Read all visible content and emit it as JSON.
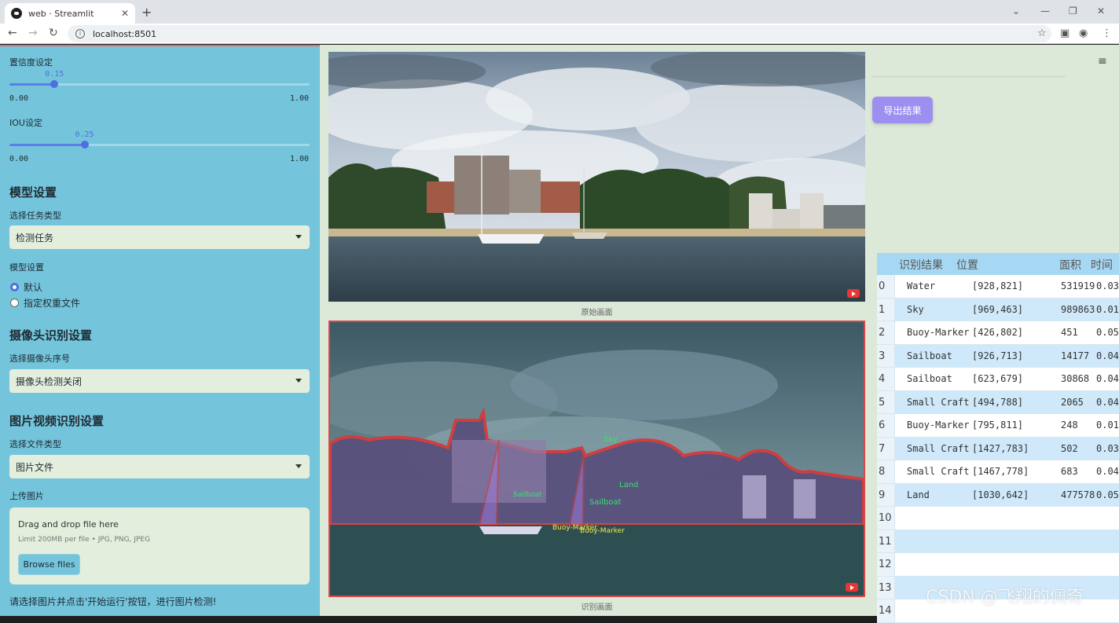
{
  "browser": {
    "tab_title": "web · Streamlit",
    "url": "localhost:8501"
  },
  "sidebar": {
    "confidence": {
      "label": "置信度设定",
      "value": "0.15",
      "fraction": 0.15,
      "min": "0.00",
      "max": "1.00"
    },
    "iou": {
      "label": "IOU设定",
      "value": "0.25",
      "fraction": 0.25,
      "min": "0.00",
      "max": "1.00"
    },
    "model_section": "模型设置",
    "task_label": "选择任务类型",
    "task_value": "检测任务",
    "model_label": "模型设置",
    "radio": [
      {
        "label": "默认",
        "selected": true
      },
      {
        "label": "指定权重文件",
        "selected": false
      }
    ],
    "camera_section": "摄像头识别设置",
    "camera_label": "选择摄像头序号",
    "camera_value": "摄像头检测关闭",
    "file_section": "图片视频识别设置",
    "file_type_label": "选择文件类型",
    "file_type_value": "图片文件",
    "upload_label": "上传图片",
    "upload_title": "Drag and drop file here",
    "upload_limit": "Limit 200MB per file • JPG, PNG, JPEG",
    "browse_label": "Browse files",
    "hint": "请选择图片并点击'开始运行'按钮，进行图片检测!"
  },
  "main": {
    "original_caption": "原始画面",
    "result_caption": "识别画面",
    "export_label": "导出结果",
    "detections": [
      "Sky",
      "Land",
      "Sailboat",
      "Sailboat",
      "Buoy-Marker",
      "Buoy-Marker"
    ],
    "table": {
      "headers": [
        "识别结果",
        "位置",
        "面积",
        "时间"
      ],
      "rows": [
        {
          "idx": "0",
          "label": "Water",
          "pos": "[928,821]",
          "area": "531919",
          "time": "0.03"
        },
        {
          "idx": "1",
          "label": "Sky",
          "pos": "[969,463]",
          "area": "989863",
          "time": "0.01"
        },
        {
          "idx": "2",
          "label": "Buoy-Marker",
          "pos": "[426,802]",
          "area": "451",
          "time": "0.05"
        },
        {
          "idx": "3",
          "label": "Sailboat",
          "pos": "[926,713]",
          "area": "14177",
          "time": "0.04"
        },
        {
          "idx": "4",
          "label": "Sailboat",
          "pos": "[623,679]",
          "area": "30868",
          "time": "0.04"
        },
        {
          "idx": "5",
          "label": "Small Craft",
          "pos": "[494,788]",
          "area": "2065",
          "time": "0.04"
        },
        {
          "idx": "6",
          "label": "Buoy-Marker",
          "pos": "[795,811]",
          "area": "248",
          "time": "0.01"
        },
        {
          "idx": "7",
          "label": "Small Craft",
          "pos": "[1427,783]",
          "area": "502",
          "time": "0.03"
        },
        {
          "idx": "8",
          "label": "Small Craft",
          "pos": "[1467,778]",
          "area": "683",
          "time": "0.04"
        },
        {
          "idx": "9",
          "label": "Land",
          "pos": "[1030,642]",
          "area": "477578",
          "time": "0.05"
        },
        {
          "idx": "10",
          "label": "",
          "pos": "",
          "area": "",
          "time": ""
        },
        {
          "idx": "11",
          "label": "",
          "pos": "",
          "area": "",
          "time": ""
        },
        {
          "idx": "12",
          "label": "",
          "pos": "",
          "area": "",
          "time": ""
        },
        {
          "idx": "13",
          "label": "",
          "pos": "",
          "area": "",
          "time": ""
        },
        {
          "idx": "14",
          "label": "",
          "pos": "",
          "area": "",
          "time": ""
        }
      ]
    }
  },
  "watermark": "CSDN @飞翔的佩奇"
}
